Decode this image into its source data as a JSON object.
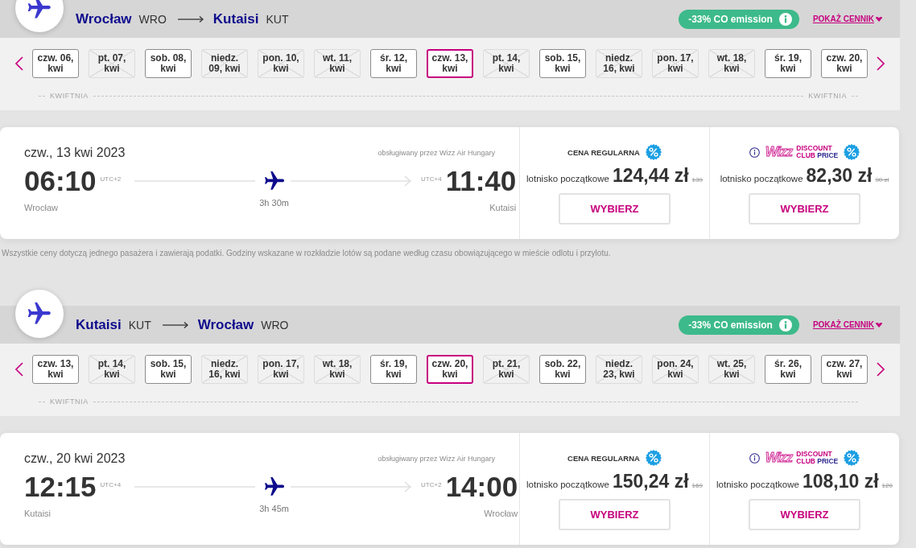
{
  "outbound": {
    "route": {
      "origin_city": "Wrocław",
      "origin_code": "WRO",
      "destination_city": "Kutaisi",
      "destination_code": "KUT"
    },
    "emission_badge": "-33% CO emission",
    "price_list_link": "POKAŻ CENNIK",
    "dates": [
      {
        "label": "czw. 06,\nkwi",
        "available": true,
        "selected": false
      },
      {
        "label": "pt. 07,\nkwi",
        "available": false,
        "selected": false
      },
      {
        "label": "sob. 08,\nkwi",
        "available": true,
        "selected": false
      },
      {
        "label": "niedz.\n09, kwi",
        "available": false,
        "selected": false
      },
      {
        "label": "pon. 10,\nkwi",
        "available": false,
        "selected": false
      },
      {
        "label": "wt. 11,\nkwi",
        "available": false,
        "selected": false
      },
      {
        "label": "śr. 12,\nkwi",
        "available": true,
        "selected": false
      },
      {
        "label": "czw. 13,\nkwi",
        "available": true,
        "selected": true
      },
      {
        "label": "pt. 14,\nkwi",
        "available": false,
        "selected": false
      },
      {
        "label": "sob. 15,\nkwi",
        "available": true,
        "selected": false
      },
      {
        "label": "niedz.\n16, kwi",
        "available": false,
        "selected": false
      },
      {
        "label": "pon. 17,\nkwi",
        "available": false,
        "selected": false
      },
      {
        "label": "wt. 18,\nkwi",
        "available": false,
        "selected": false
      },
      {
        "label": "śr. 19,\nkwi",
        "available": true,
        "selected": false
      },
      {
        "label": "czw. 20,\nkwi",
        "available": true,
        "selected": false
      }
    ],
    "months": [
      "KWIFTNIA",
      "KWIFTNIA"
    ],
    "flight": {
      "date": "czw., 13 kwi 2023",
      "operator": "obsługiwany przez Wizz Air Hungary",
      "departure": {
        "time": "06:10",
        "timezone": "UTC+2",
        "city": "Wrocław"
      },
      "duration": "3h 30m",
      "arrival": {
        "time": "11:40",
        "timezone": "UTC+4",
        "city": "Kutaisi"
      }
    },
    "fares": [
      {
        "kind": "regular",
        "title": "CENA REGULARNA",
        "price_label": "lotnisko początkowe",
        "price": "124,44 zł",
        "old_price": "139",
        "button": "WYBIERZ"
      },
      {
        "kind": "club",
        "logo": {
          "wordmark": "Wizz",
          "top_line": "DISCOUNT",
          "bottom_line_start": "CLUB",
          "bottom_line_end": "PRICE"
        },
        "price_label": "lotnisko początkowe",
        "price": "82,30 zł",
        "old_price": "90 zł",
        "button": "WYBIERZ"
      }
    ]
  },
  "note": "Wszystkie ceny dotyczą jednego pasażera i zawierają podatki. Godziny wskazane w rozkładzie lotów są podane według czasu obowiązującego w mieście odlotu i przylotu.",
  "inbound": {
    "route": {
      "origin_city": "Kutaisi",
      "origin_code": "KUT",
      "destination_city": "Wrocław",
      "destination_code": "WRO"
    },
    "emission_badge": "-33% CO emission",
    "price_list_link": "POKAŻ CENNIK",
    "dates": [
      {
        "label": "czw. 13,\nkwi",
        "available": true,
        "selected": false
      },
      {
        "label": "pt. 14,\nkwi",
        "available": false,
        "selected": false
      },
      {
        "label": "sob. 15,\nkwi",
        "available": true,
        "selected": false
      },
      {
        "label": "niedz.\n16, kwi",
        "available": false,
        "selected": false
      },
      {
        "label": "pon. 17,\nkwi",
        "available": false,
        "selected": false
      },
      {
        "label": "wt. 18,\nkwi",
        "available": false,
        "selected": false
      },
      {
        "label": "śr. 19,\nkwi",
        "available": true,
        "selected": false
      },
      {
        "label": "czw. 20,\nkwi",
        "available": true,
        "selected": true
      },
      {
        "label": "pt. 21,\nkwi",
        "available": false,
        "selected": false
      },
      {
        "label": "sob. 22,\nkwi",
        "available": true,
        "selected": false
      },
      {
        "label": "niedz.\n23, kwi",
        "available": false,
        "selected": false
      },
      {
        "label": "pon. 24,\nkwi",
        "available": false,
        "selected": false
      },
      {
        "label": "wt. 25,\nkwi",
        "available": false,
        "selected": false
      },
      {
        "label": "śr. 26,\nkwi",
        "available": true,
        "selected": false
      },
      {
        "label": "czw. 27,\nkwi",
        "available": true,
        "selected": false
      }
    ],
    "months": [
      "KWIFTNIA"
    ],
    "flight": {
      "date": "czw., 20 kwi 2023",
      "operator": "obsługiwany przez Wizz Air Hungary",
      "departure": {
        "time": "12:15",
        "timezone": "UTC+4",
        "city": "Kutaisi"
      },
      "duration": "3h 45m",
      "arrival": {
        "time": "14:00",
        "timezone": "UTC+2",
        "city": "Wrocław"
      }
    },
    "fares": [
      {
        "kind": "regular",
        "title": "CENA REGULARNA",
        "price_label": "lotnisko początkowe",
        "price": "150,24 zł",
        "old_price": "169",
        "button": "WYBIERZ"
      },
      {
        "kind": "club",
        "logo": {
          "wordmark": "Wizz",
          "top_line": "DISCOUNT",
          "bottom_line_start": "CLUB",
          "bottom_line_end": "PRICE"
        },
        "price_label": "lotnisko początkowe",
        "price": "108,10 zł",
        "old_price": "120",
        "button": "WYBIERZ"
      }
    ]
  }
}
